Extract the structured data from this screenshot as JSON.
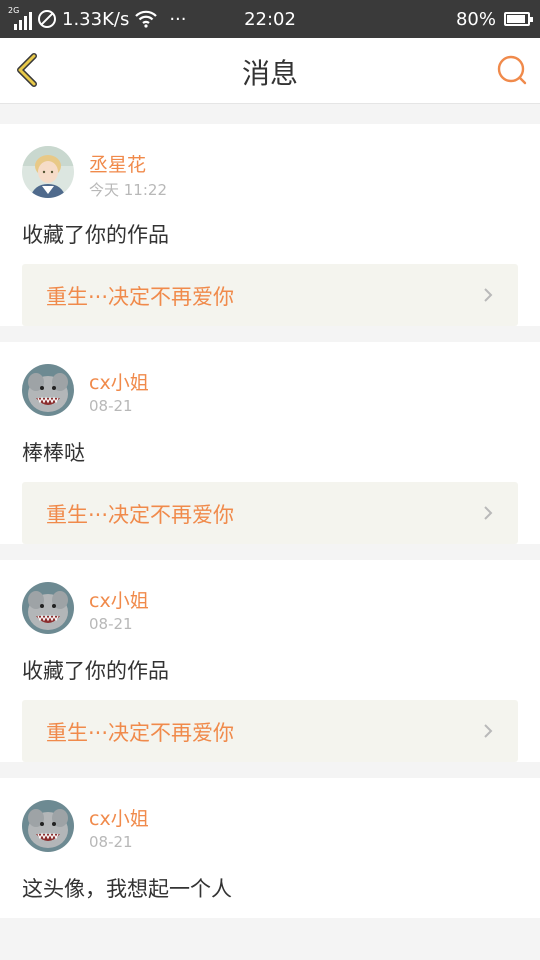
{
  "status_bar": {
    "network_type": "2G",
    "speed": "1.33K/s",
    "more": "···",
    "time": "22:02",
    "battery": "80%"
  },
  "header": {
    "title": "消息",
    "back_icon": "chevron-left-icon",
    "search_icon": "search-icon"
  },
  "colors": {
    "accent": "#f08a4b",
    "back_icon": "#e8c94a",
    "link_bg": "#f4f4ee"
  },
  "messages": [
    {
      "username": "丞星花",
      "time": "今天 11:22",
      "content": "收藏了你的作品",
      "work_title": "重生···决定不再爱你"
    },
    {
      "username": "cx小姐",
      "time": "08-21",
      "content": "棒棒哒",
      "work_title": "重生···决定不再爱你"
    },
    {
      "username": "cx小姐",
      "time": "08-21",
      "content": "收藏了你的作品",
      "work_title": "重生···决定不再爱你"
    },
    {
      "username": "cx小姐",
      "time": "08-21",
      "content": "这头像，我想起一个人",
      "work_title": ""
    }
  ]
}
